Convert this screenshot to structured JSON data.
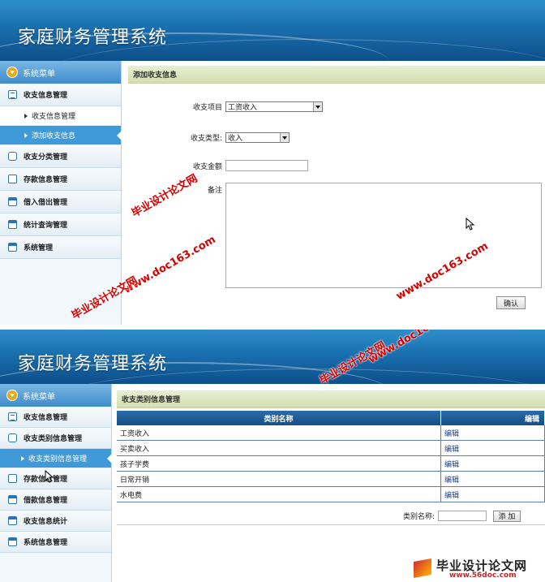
{
  "app_title": "家庭财务管理系统",
  "screen1": {
    "sidebar": {
      "header": "系统菜单",
      "items": [
        {
          "label": "收支信息管理",
          "icon": "list-icon"
        },
        {
          "label": "收支分类管理",
          "icon": "chat-icon"
        },
        {
          "label": "存款信息管理",
          "icon": "edit-icon"
        },
        {
          "label": "借入借出管理",
          "icon": "calendar-icon"
        },
        {
          "label": "统计查询管理",
          "icon": "calendar-icon"
        },
        {
          "label": "系统管理",
          "icon": "calendar-icon"
        }
      ],
      "sub_items": [
        "收支信息管理",
        "添加收支信息"
      ]
    },
    "main": {
      "title": "添加收支信息",
      "fields": {
        "item_label": "收支项目",
        "item_value": "工资收入",
        "type_label": "收支类型:",
        "type_value": "收入",
        "amount_label": "收支金额",
        "amount_value": "",
        "note_label": "备注",
        "note_value": ""
      },
      "confirm_button": "确认"
    }
  },
  "screen2": {
    "sidebar": {
      "header": "系统菜单",
      "items": [
        {
          "label": "收支信息管理",
          "icon": "list-icon"
        },
        {
          "label": "收支类别信息管理",
          "icon": "chat-icon"
        },
        {
          "label": "存款信息管理",
          "icon": "edit-icon"
        },
        {
          "label": "借款信息管理",
          "icon": "calendar-icon"
        },
        {
          "label": "收支信息统计",
          "icon": "calendar-icon"
        },
        {
          "label": "系统信息管理",
          "icon": "calendar-icon"
        }
      ],
      "sub_item": "收支类别信息管理"
    },
    "main": {
      "title": "收支类别信息管理",
      "table": {
        "headers": [
          "类别名称",
          "编辑"
        ],
        "rows": [
          {
            "name": "工资收入",
            "action": "编辑"
          },
          {
            "name": "买卖收入",
            "action": "编辑"
          },
          {
            "name": "孩子学费",
            "action": "编辑"
          },
          {
            "name": "日常开销",
            "action": "编辑"
          },
          {
            "name": "水电费",
            "action": "编辑"
          }
        ]
      },
      "footer": {
        "label": "类别名称:",
        "input_value": "",
        "add_button": "添 加"
      }
    }
  },
  "watermarks": {
    "site_name": "毕业设计论文网",
    "site_url": "www.doc163.com",
    "logo_text": "毕业设计论文网",
    "logo_url": "www.56doc.com"
  },
  "colors": {
    "banner": "#1a6fae",
    "menu_active": "#3e9ad8",
    "table_header": "#1f5c98",
    "section_header": "#d9e2bb",
    "watermark": "#d50000"
  }
}
